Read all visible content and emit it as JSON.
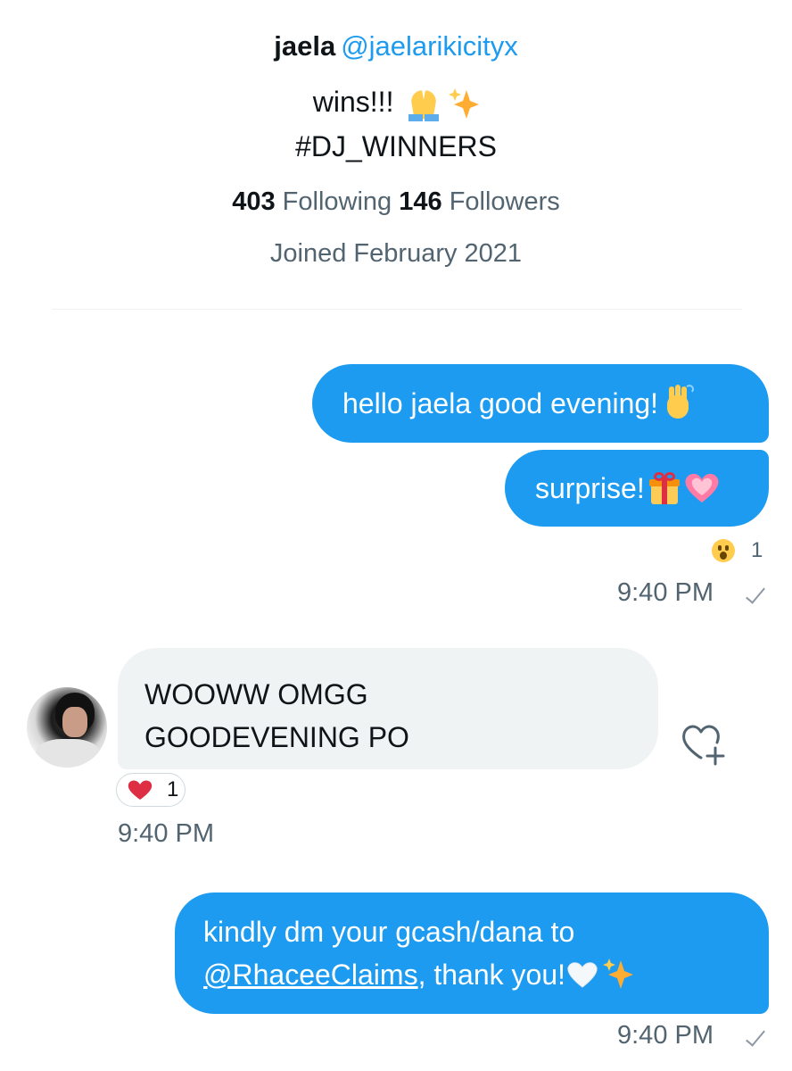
{
  "profile": {
    "display_name": "jaela",
    "handle": "@jaelarikicityx",
    "bio_line1": "wins!!!",
    "bio_line2": "#DJ_WINNERS",
    "following_count": "403",
    "following_label": "Following",
    "followers_count": "146",
    "followers_label": "Followers",
    "joined": "Joined February 2021"
  },
  "messages": [
    {
      "direction": "outgoing",
      "text": "hello jaela good evening!",
      "emoji": [
        "waving-hand"
      ]
    },
    {
      "direction": "outgoing",
      "text": "surprise!",
      "emoji": [
        "gift",
        "growing-heart"
      ],
      "reaction": {
        "emoji": "astonished-face",
        "count": "1"
      },
      "time": "9:40 PM",
      "status": "sent-check"
    },
    {
      "direction": "incoming",
      "line1": "WOOWW OMGG",
      "line2": "GOODEVENING PO",
      "reaction": {
        "emoji": "red-heart",
        "count": "1"
      },
      "time": "9:40 PM"
    },
    {
      "direction": "outgoing",
      "line1": "kindly dm your gcash/dana to",
      "mention": "@RhaceeClaims",
      "line2_rest": ", thank you!",
      "emoji": [
        "white-heart",
        "sparkles"
      ],
      "time": "9:40 PM",
      "status": "sent-check"
    }
  ],
  "colors": {
    "accent": "#1d9bf0",
    "incoming_bubble": "#eff3f4",
    "secondary_text": "#536471",
    "heart": "#e0245e"
  }
}
